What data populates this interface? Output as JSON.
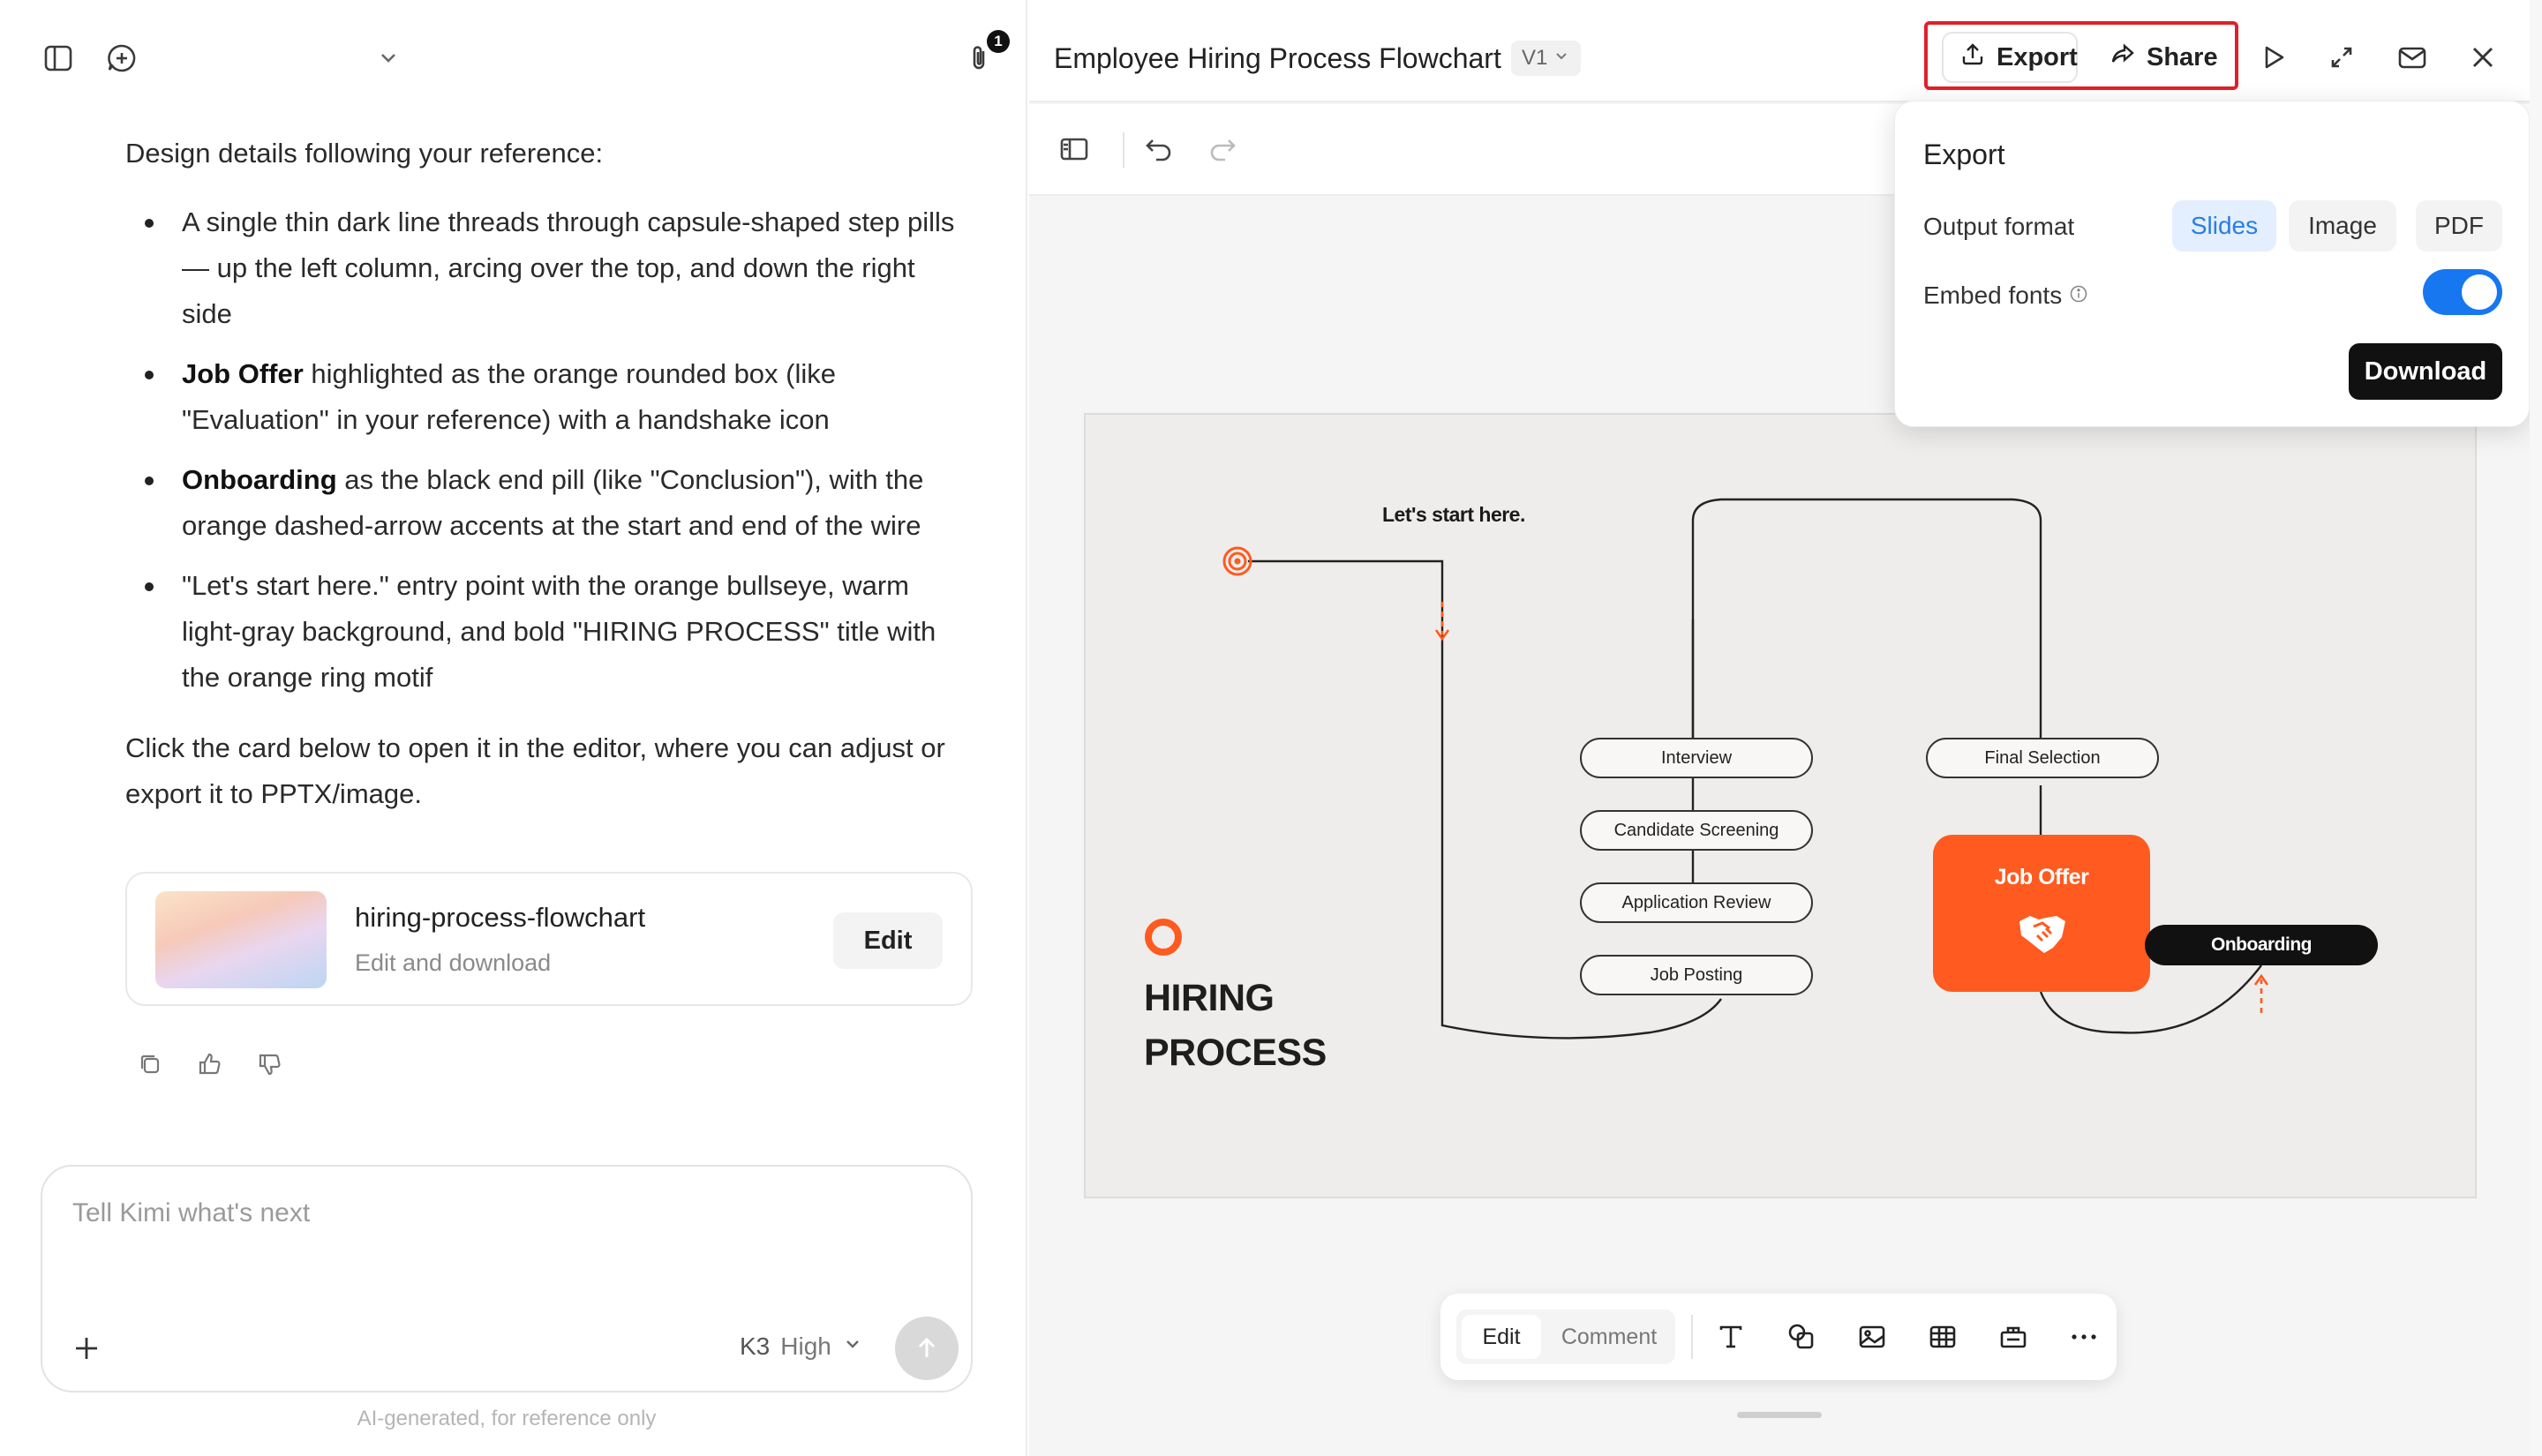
{
  "chat": {
    "intro": "Design details following your reference:",
    "bullets": [
      {
        "bold": "",
        "text": "A single thin dark line threads through capsule-shaped step pills — up the left column, arcing over the top, and down the right side"
      },
      {
        "bold": "Job Offer",
        "text": " highlighted as the orange rounded box (like \"Evaluation\" in your reference) with a handshake icon"
      },
      {
        "bold": "Onboarding",
        "text": " as the black end pill (like \"Conclusion\"), with the orange dashed-arrow accents at the start and end of the wire"
      },
      {
        "bold": "",
        "text": "\"Let's start here.\" entry point with the orange bullseye, warm light-gray background, and bold \"HIRING PROCESS\" title with the orange ring motif"
      }
    ],
    "outro": "Click the card below to open it in the editor, where you can adjust or export it to PPTX/image."
  },
  "file_card": {
    "name": "hiring-process-flowchart",
    "subtitle": "Edit and download",
    "edit_label": "Edit"
  },
  "attachment_badge": "1",
  "composer": {
    "placeholder": "Tell Kimi what's next",
    "model": "K3",
    "model_level": "High",
    "disclaimer": "AI-generated, for reference only"
  },
  "editor": {
    "title": "Employee Hiring Process Flowchart",
    "version": "V1",
    "export_label": "Export",
    "share_label": "Share"
  },
  "export_panel": {
    "title": "Export",
    "output_format_label": "Output format",
    "formats": [
      "Slides",
      "Image",
      "PDF"
    ],
    "selected_format": "Slides",
    "embed_fonts_label": "Embed fonts",
    "embed_fonts_on": true,
    "download_label": "Download"
  },
  "slide": {
    "start_label": "Let's start here.",
    "title_line1": "HIRING",
    "title_line2": "PROCESS",
    "steps_left": [
      "Interview",
      "Candidate Screening",
      "Application Review",
      "Job Posting"
    ],
    "step_right": "Final Selection",
    "highlight": "Job Offer",
    "end": "Onboarding",
    "accent_color": "#ff5a1f"
  },
  "bottom_toolbar": {
    "edit_label": "Edit",
    "comment_label": "Comment"
  }
}
